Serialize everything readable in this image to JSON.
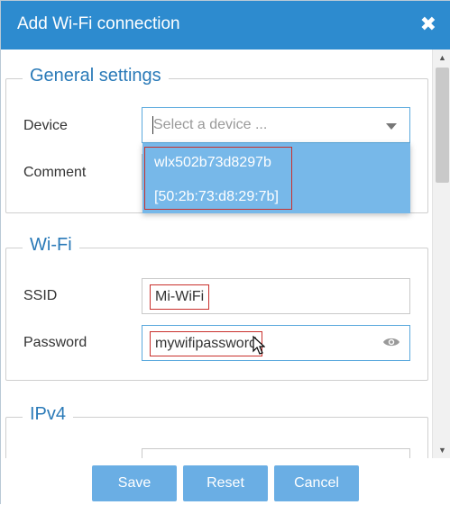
{
  "dialog": {
    "title": "Add Wi-Fi connection",
    "close_icon": "close-icon"
  },
  "general": {
    "legend": "General settings",
    "device_label": "Device",
    "device_placeholder": "Select a device ...",
    "comment_label": "Comment",
    "dropdown_options": [
      {
        "line1": "wlx502b73d8297b",
        "line2": "[50:2b:73:d8:29:7b]",
        "highlighted": true
      }
    ]
  },
  "wifi": {
    "legend": "Wi-Fi",
    "ssid_label": "SSID",
    "ssid_value": "Mi-WiFi",
    "password_label": "Password",
    "password_value": "mywifipassword",
    "show_password_icon": "eye-icon"
  },
  "ipv4": {
    "legend": "IPv4"
  },
  "buttons": {
    "save": "Save",
    "reset": "Reset",
    "cancel": "Cancel"
  },
  "colors": {
    "titlebar": "#2d8bcf",
    "accent": "#2a7ab8",
    "dropdown": "#77b8e9",
    "button": "#6aaee4",
    "highlight_border": "#c9302c"
  }
}
